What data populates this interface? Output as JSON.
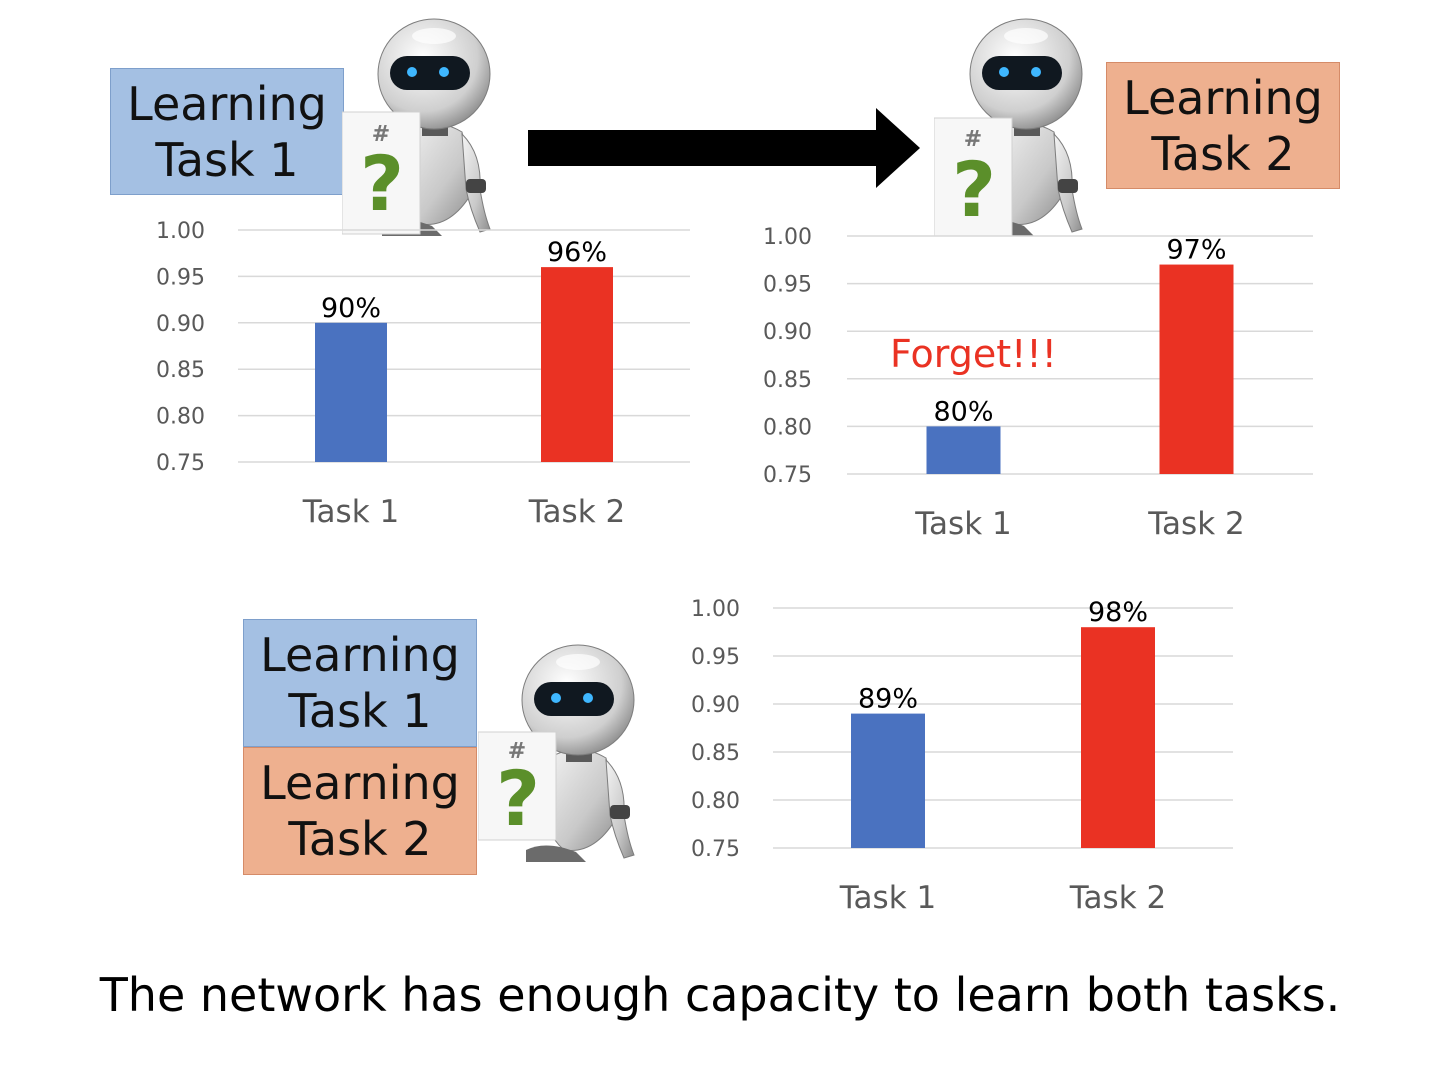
{
  "boxes": {
    "top_left": {
      "line1": "Learning",
      "line2": "Task 1"
    },
    "top_right": {
      "line1": "Learning",
      "line2": "Task 2"
    },
    "bottom_task1": {
      "line1": "Learning",
      "line2": "Task 1"
    },
    "bottom_task2": {
      "line1": "Learning",
      "line2": "Task 2"
    }
  },
  "robot": {
    "sign_symbol": "?",
    "sign_mark": "#"
  },
  "forget_label": "Forget!!!",
  "caption": "The network has enough capacity to learn both tasks.",
  "colors": {
    "task1": "#4a72c0",
    "task2": "#ea3223",
    "forget": "#ea3223",
    "blue_box": "#a4c0e3",
    "orange_box": "#eeb08f"
  },
  "chart_data": [
    {
      "type": "bar",
      "categories": [
        "Task 1",
        "Task 2"
      ],
      "values": [
        0.9,
        0.96
      ],
      "data_labels": [
        "90%",
        "96%"
      ],
      "ylim": [
        0.75,
        1.0
      ],
      "yticks": [
        "1.00",
        "0.95",
        "0.90",
        "0.85",
        "0.80",
        "0.75"
      ],
      "grid": true
    },
    {
      "type": "bar",
      "categories": [
        "Task 1",
        "Task 2"
      ],
      "values": [
        0.8,
        0.97
      ],
      "data_labels": [
        "80%",
        "97%"
      ],
      "ylim": [
        0.75,
        1.0
      ],
      "yticks": [
        "1.00",
        "0.95",
        "0.90",
        "0.85",
        "0.80",
        "0.75"
      ],
      "grid": true
    },
    {
      "type": "bar",
      "categories": [
        "Task 1",
        "Task 2"
      ],
      "values": [
        0.89,
        0.98
      ],
      "data_labels": [
        "89%",
        "98%"
      ],
      "ylim": [
        0.75,
        1.0
      ],
      "yticks": [
        "1.00",
        "0.95",
        "0.90",
        "0.85",
        "0.80",
        "0.75"
      ],
      "grid": true
    }
  ]
}
